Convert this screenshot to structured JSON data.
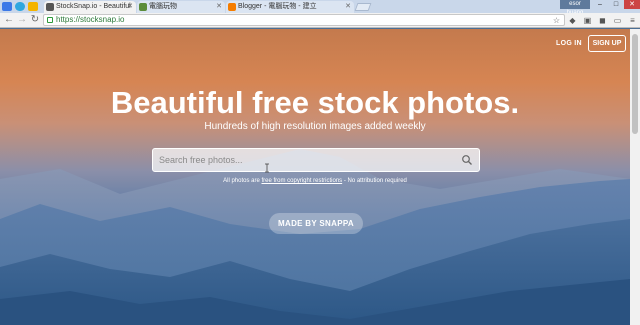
{
  "browser": {
    "tabs": [
      {
        "title": "StockSnap.io - Beautiful",
        "active": true
      },
      {
        "title": "電腦玩物",
        "active": false
      },
      {
        "title": "Blogger - 電腦玩物 - 建立",
        "active": false
      }
    ],
    "profile_label": "esor huang",
    "url": "https://stocksnap.io",
    "window_controls": {
      "minimize": "–",
      "maximize": "□",
      "close": "✕"
    }
  },
  "nav": {
    "login": "LOG IN",
    "signup": "SIGN UP"
  },
  "hero": {
    "title": "Beautiful free stock photos.",
    "subtitle": "Hundreds of high resolution images added weekly"
  },
  "search": {
    "placeholder": "Search free photos..."
  },
  "notice": {
    "prefix": "All photos are ",
    "link": "free from copyright restrictions",
    "suffix": " - No attribution required"
  },
  "made_by": "MADE BY SNAPPA",
  "colors": {
    "sky_top": "#c47a4d",
    "sky_mid": "#d68553",
    "mountain_far": "#6c87b0",
    "mountain_mid": "#4c6f9c",
    "mountain_near": "#2f5a88",
    "url_green": "#2d7b3a"
  }
}
